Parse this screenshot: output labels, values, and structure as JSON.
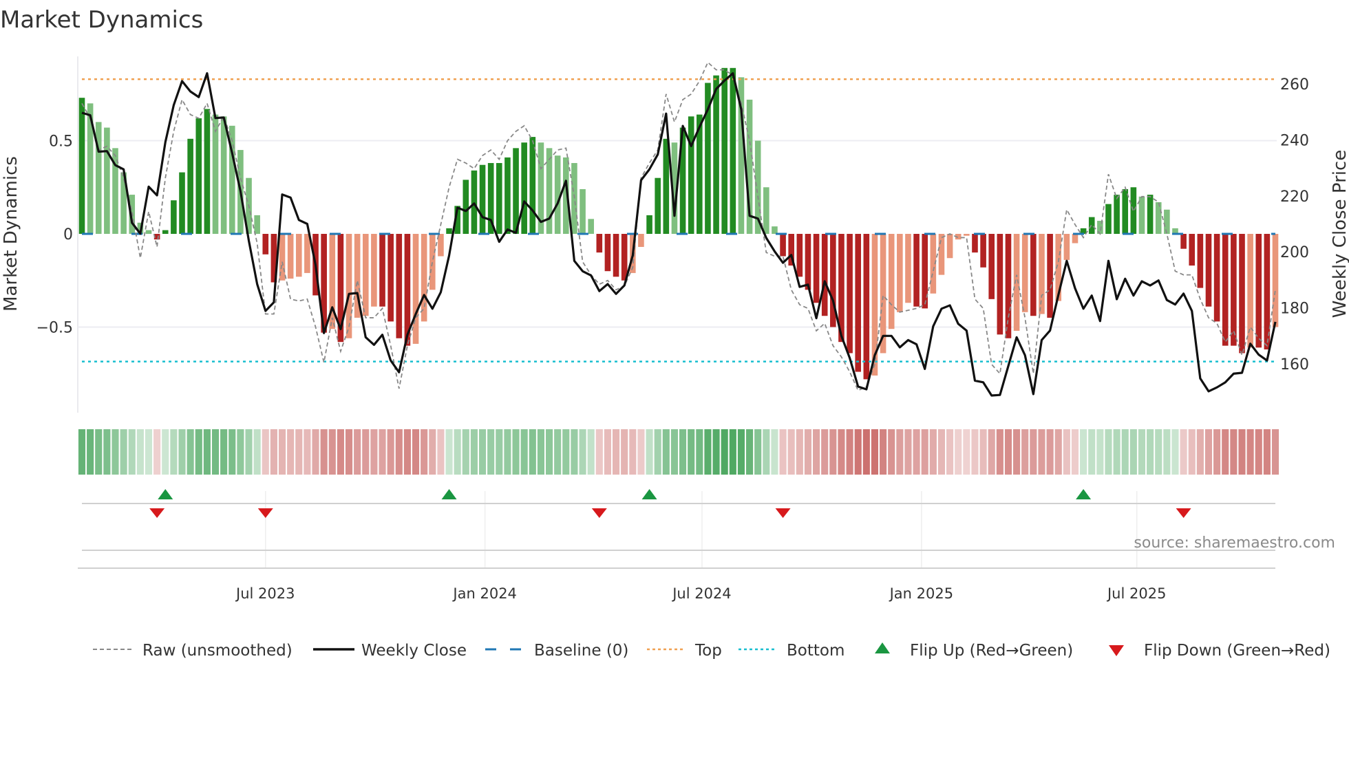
{
  "title": "Market Dynamics",
  "source": "source: sharemaestro.com",
  "colors": {
    "pos_strong": "#228b22",
    "pos_weak": "#7fbf7f",
    "neg_strong": "#b22222",
    "neg_weak": "#e9967a",
    "close": "#111111",
    "raw": "#888888",
    "baseline": "#1f77b4",
    "top": "#f0a050",
    "bottom": "#17becf",
    "flip_up": "#1a9641",
    "flip_down": "#d7191c",
    "strip_pos": "#3a9e50",
    "strip_neg": "#c0504d"
  },
  "chart_data": {
    "type": "bar",
    "title": "Market Dynamics",
    "xlabel": "",
    "ylabel": "Market Dynamics",
    "ylabel_right": "Weekly Close Price",
    "x_unit": "week index",
    "ylim": [
      -0.95,
      1.0
    ],
    "ylim_right": [
      143,
      268
    ],
    "left_ticks": [
      {
        "v": 0.5,
        "label": "0.5"
      },
      {
        "v": 0,
        "label": "0"
      },
      {
        "v": -0.5,
        "label": "−0.5"
      }
    ],
    "right_ticks": [
      {
        "v": 260,
        "label": "260"
      },
      {
        "v": 240,
        "label": "240"
      },
      {
        "v": 220,
        "label": "220"
      },
      {
        "v": 200,
        "label": "200"
      },
      {
        "v": 180,
        "label": "180"
      },
      {
        "v": 160,
        "label": "160"
      }
    ],
    "x_ticks": [
      {
        "x": 22.0,
        "label": "Jul 2023"
      },
      {
        "x": 48.3,
        "label": "Jan 2024"
      },
      {
        "x": 74.3,
        "label": "Jul 2024"
      },
      {
        "x": 100.6,
        "label": "Jan 2025"
      },
      {
        "x": 126.4,
        "label": "Jul 2025"
      }
    ],
    "top_level": 0.83,
    "bottom_level": -0.685,
    "baseline": 0,
    "dynamics": [
      0.73,
      0.7,
      0.6,
      0.57,
      0.46,
      0.33,
      0.21,
      0.06,
      0.02,
      -0.03,
      0.02,
      0.18,
      0.33,
      0.51,
      0.62,
      0.67,
      0.64,
      0.63,
      0.58,
      0.45,
      0.3,
      0.1,
      -0.11,
      -0.26,
      -0.25,
      -0.24,
      -0.23,
      -0.21,
      -0.33,
      -0.53,
      -0.51,
      -0.58,
      -0.56,
      -0.45,
      -0.44,
      -0.39,
      -0.39,
      -0.47,
      -0.56,
      -0.6,
      -0.59,
      -0.47,
      -0.3,
      -0.12,
      0.03,
      0.15,
      0.29,
      0.34,
      0.37,
      0.38,
      0.38,
      0.41,
      0.46,
      0.49,
      0.52,
      0.49,
      0.46,
      0.42,
      0.41,
      0.38,
      0.24,
      0.08,
      -0.1,
      -0.2,
      -0.23,
      -0.25,
      -0.21,
      -0.07,
      0.1,
      0.3,
      0.51,
      0.49,
      0.57,
      0.63,
      0.64,
      0.81,
      0.85,
      0.89,
      0.89,
      0.84,
      0.72,
      0.5,
      0.25,
      0.04,
      -0.12,
      -0.17,
      -0.23,
      -0.3,
      -0.37,
      -0.44,
      -0.5,
      -0.58,
      -0.64,
      -0.74,
      -0.78,
      -0.76,
      -0.64,
      -0.51,
      -0.42,
      -0.37,
      -0.39,
      -0.4,
      -0.32,
      -0.22,
      -0.13,
      -0.03,
      -0.01,
      -0.1,
      -0.18,
      -0.35,
      -0.54,
      -0.56,
      -0.52,
      -0.42,
      -0.44,
      -0.43,
      -0.45,
      -0.36,
      -0.14,
      -0.05,
      0.03,
      0.09,
      0.07,
      0.16,
      0.21,
      0.24,
      0.25,
      0.2,
      0.21,
      0.17,
      0.13,
      0.03,
      -0.08,
      -0.17,
      -0.29,
      -0.39,
      -0.47,
      -0.6,
      -0.6,
      -0.64,
      -0.61,
      -0.61,
      -0.62,
      -0.5
    ],
    "raw": [
      0.7,
      0.62,
      0.45,
      0.47,
      0.42,
      0.3,
      0.12,
      -0.13,
      0.12,
      -0.07,
      0.3,
      0.55,
      0.72,
      0.64,
      0.62,
      0.7,
      0.55,
      0.63,
      0.5,
      0.3,
      0.15,
      -0.05,
      -0.43,
      -0.43,
      -0.15,
      -0.35,
      -0.36,
      -0.35,
      -0.5,
      -0.69,
      -0.45,
      -0.63,
      -0.5,
      -0.25,
      -0.45,
      -0.45,
      -0.4,
      -0.6,
      -0.83,
      -0.6,
      -0.45,
      -0.4,
      -0.15,
      0.05,
      0.25,
      0.4,
      0.38,
      0.35,
      0.42,
      0.45,
      0.4,
      0.5,
      0.55,
      0.58,
      0.5,
      0.35,
      0.4,
      0.45,
      0.46,
      0.2,
      -0.15,
      -0.22,
      -0.27,
      -0.25,
      -0.3,
      -0.28,
      -0.18,
      0.3,
      0.38,
      0.45,
      0.75,
      0.6,
      0.72,
      0.75,
      0.82,
      0.92,
      0.88,
      0.88,
      0.85,
      0.7,
      0.5,
      0.2,
      -0.1,
      -0.12,
      -0.12,
      -0.3,
      -0.38,
      -0.4,
      -0.52,
      -0.48,
      -0.6,
      -0.66,
      -0.74,
      -0.84,
      -0.82,
      -0.7,
      -0.33,
      -0.38,
      -0.42,
      -0.41,
      -0.4,
      -0.38,
      -0.2,
      -0.02,
      0,
      -0.02,
      -0.02,
      -0.35,
      -0.4,
      -0.7,
      -0.75,
      -0.45,
      -0.22,
      -0.45,
      -0.75,
      -0.33,
      -0.3,
      -0.15,
      0.13,
      0.05,
      -0.02,
      0.05,
      0,
      0.32,
      0.19,
      0.25,
      0.12,
      0.2,
      0.2,
      0.17,
      0,
      -0.2,
      -0.22,
      -0.22,
      -0.35,
      -0.45,
      -0.48,
      -0.58,
      -0.52,
      -0.65,
      -0.5,
      -0.56,
      -0.6,
      -0.3
    ],
    "weekly_close": [
      249.7,
      248.8,
      235.8,
      236,
      231,
      229.5,
      210.4,
      206.5,
      223.3,
      220.2,
      239.2,
      252.4,
      261,
      257.3,
      255.3,
      263.8,
      247.8,
      248,
      235.3,
      221.7,
      204,
      188.5,
      178.9,
      182,
      220.5,
      219.4,
      211.4,
      210,
      195.3,
      171,
      180.2,
      172.4,
      185,
      185.3,
      169.5,
      166.8,
      170.4,
      161.2,
      157,
      170.4,
      177.8,
      184.6,
      179.7,
      185.6,
      198.7,
      215.8,
      214.6,
      217.3,
      212.4,
      211.4,
      203.6,
      208,
      206.8,
      218,
      214.8,
      210.7,
      211.9,
      217.3,
      225.4,
      196.8,
      193.1,
      191.6,
      186,
      188.5,
      185,
      188,
      198.7,
      225.6,
      229.5,
      234.8,
      249.4,
      212.9,
      245,
      237.8,
      244.6,
      250.9,
      258.2,
      261.2,
      263.8,
      250.9,
      212.9,
      211.9,
      205,
      200.2,
      196.1,
      198.9,
      187.5,
      188.3,
      176.3,
      189.5,
      182.6,
      170,
      162.1,
      151.9,
      150.9,
      163.1,
      170,
      170,
      165.9,
      168.5,
      167,
      158.2,
      173.4,
      179.7,
      180.9,
      174.3,
      171.9,
      154,
      153.4,
      148.7,
      148.9,
      159.2,
      169.5,
      163.1,
      149.2,
      168.5,
      171.9,
      184.6,
      196.8,
      187,
      179.7,
      184.4,
      175.3,
      196.8,
      183.1,
      190.4,
      184.4,
      189.5,
      188,
      189.8,
      182.8,
      181.2,
      185.1,
      178.9,
      154.8,
      150.2,
      151.6,
      153.4,
      156.5,
      156.8,
      167.2,
      163.3,
      161.2,
      175
    ],
    "flip_up_weeks": [
      10,
      44,
      68,
      120
    ],
    "flip_down_weeks": [
      9,
      22,
      62,
      84,
      132
    ],
    "legend": {
      "placement": "bottom",
      "raw": "Raw (unsmoothed)",
      "close": "Weekly Close",
      "baseline": "Baseline (0)",
      "top": "Top",
      "bottom": "Bottom",
      "flip_up": "Flip Up (Red→Green)",
      "flip_down": "Flip Down (Green→Red)"
    }
  }
}
